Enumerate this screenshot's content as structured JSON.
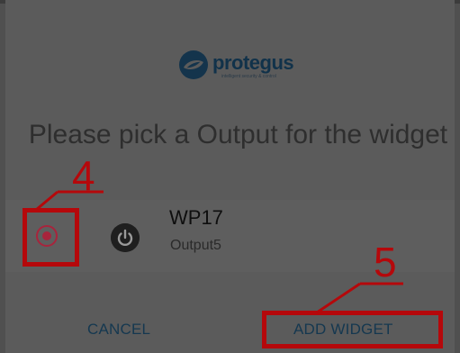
{
  "logo": {
    "name": "protegus",
    "tagline": "intelligent security & control"
  },
  "dialog": {
    "title": "Please pick a Output for the widget"
  },
  "output_list": [
    {
      "name": "WP17",
      "output": "Output5",
      "selected": true
    }
  ],
  "actions": {
    "cancel_label": "CANCEL",
    "add_label": "ADD WIDGET"
  },
  "annotations": {
    "step_radio": "4",
    "step_add": "5"
  },
  "colors": {
    "accent_radio": "#a8243c",
    "annotation_red": "#b5080b",
    "button_text": "#153850"
  }
}
